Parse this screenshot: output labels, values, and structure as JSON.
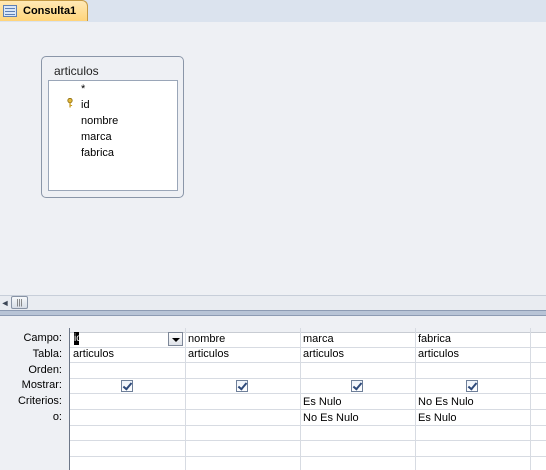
{
  "tab": {
    "label": "Consulta1",
    "icon": "query-icon"
  },
  "table_window": {
    "title": "articulos",
    "fields": [
      "*",
      "id",
      "nombre",
      "marca",
      "fabrica"
    ],
    "primary_key_field": "id"
  },
  "grid": {
    "row_labels": [
      "Campo:",
      "Tabla:",
      "Orden:",
      "Mostrar:",
      "Criterios:",
      "o:"
    ],
    "columns": [
      {
        "campo": "id",
        "tabla": "articulos",
        "orden": "",
        "mostrar": true,
        "criterios": "",
        "o": ""
      },
      {
        "campo": "nombre",
        "tabla": "articulos",
        "orden": "",
        "mostrar": true,
        "criterios": "",
        "o": ""
      },
      {
        "campo": "marca",
        "tabla": "articulos",
        "orden": "",
        "mostrar": true,
        "criterios": "Es Nulo",
        "o": "No Es Nulo"
      },
      {
        "campo": "fabrica",
        "tabla": "articulos",
        "orden": "",
        "mostrar": true,
        "criterios": "No Es Nulo",
        "o": "Es Nulo"
      }
    ]
  },
  "scrollbar": {
    "thumb_glyph": "|||",
    "left_arrow": "◄"
  }
}
